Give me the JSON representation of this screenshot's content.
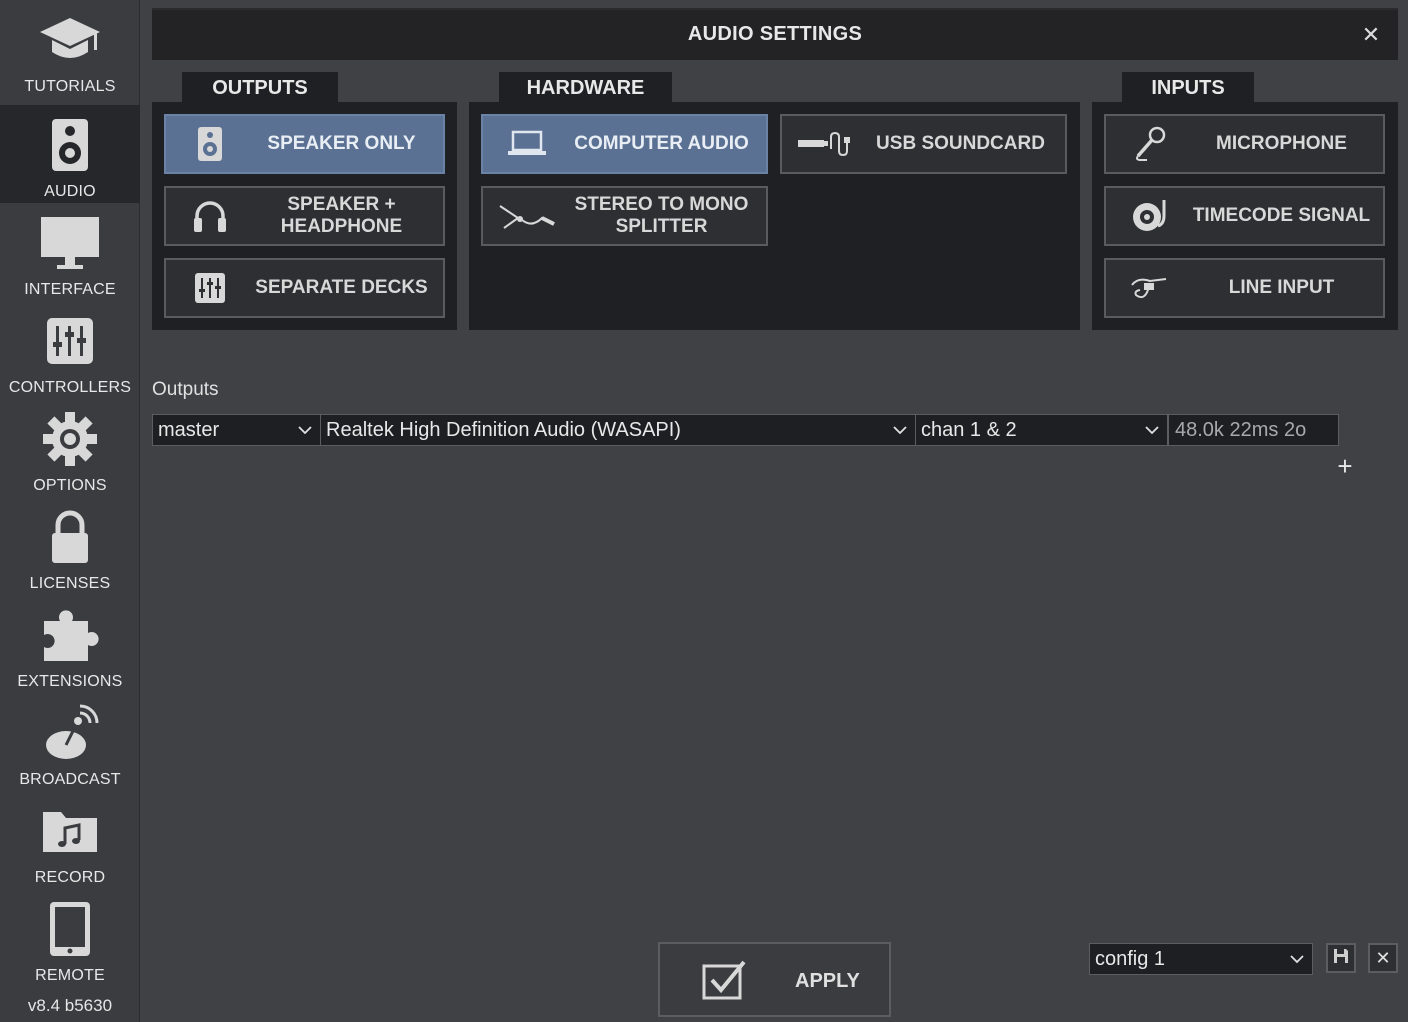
{
  "sidebar": {
    "items": [
      {
        "label": "TUTORIALS",
        "icon": "graduation-cap-icon"
      },
      {
        "label": "AUDIO",
        "icon": "speaker-icon"
      },
      {
        "label": "INTERFACE",
        "icon": "monitor-icon"
      },
      {
        "label": "CONTROLLERS",
        "icon": "mixer-sliders-icon"
      },
      {
        "label": "OPTIONS",
        "icon": "gear-icon"
      },
      {
        "label": "LICENSES",
        "icon": "lock-icon"
      },
      {
        "label": "EXTENSIONS",
        "icon": "puzzle-icon"
      },
      {
        "label": "BROADCAST",
        "icon": "satellite-dish-icon"
      },
      {
        "label": "RECORD",
        "icon": "music-folder-icon"
      },
      {
        "label": "REMOTE",
        "icon": "tablet-icon"
      }
    ],
    "active": "AUDIO",
    "version": "v8.4 b5630"
  },
  "window": {
    "title": "AUDIO SETTINGS",
    "close": "✕"
  },
  "outputs_panel": {
    "tab": "OUTPUTS",
    "buttons": [
      {
        "label": "SPEAKER ONLY",
        "icon": "speaker-icon",
        "selected": true
      },
      {
        "label": "SPEAKER + HEADPHONE",
        "line1": "SPEAKER +",
        "line2": "HEADPHONE",
        "icon": "headphones-icon",
        "selected": false
      },
      {
        "label": "SEPARATE DECKS",
        "icon": "mixer-sliders-icon",
        "selected": false
      }
    ]
  },
  "hardware_panel": {
    "tab": "HARDWARE",
    "buttons": [
      {
        "label": "COMPUTER AUDIO",
        "icon": "laptop-icon",
        "selected": true
      },
      {
        "label": "USB SOUNDCARD",
        "icon": "usb-cable-icon",
        "selected": false
      },
      {
        "label": "STEREO TO MONO SPLITTER",
        "line1": "STEREO TO MONO",
        "line2": "SPLITTER",
        "icon": "splitter-cable-icon",
        "selected": false
      }
    ]
  },
  "inputs_panel": {
    "tab": "INPUTS",
    "buttons": [
      {
        "label": "MICROPHONE",
        "icon": "microphone-icon",
        "selected": false
      },
      {
        "label": "TIMECODE SIGNAL",
        "icon": "turntable-icon",
        "selected": false
      },
      {
        "label": "LINE INPUT",
        "icon": "jack-cable-icon",
        "selected": false
      }
    ]
  },
  "outputs_section": {
    "label": "Outputs",
    "row": {
      "output": "master",
      "device": "Realtek High Definition Audio (WASAPI)",
      "channels": "chan 1 & 2",
      "format": "48.0k 22ms 2o"
    },
    "add": "+"
  },
  "footer": {
    "apply": "APPLY",
    "config": "config 1",
    "save_icon": "floppy-disk-icon",
    "delete": "✕"
  },
  "colors": {
    "background": "#404145",
    "panel": "#1f2023",
    "selected": "#5a7193",
    "sidebar_active": "#26272a"
  }
}
